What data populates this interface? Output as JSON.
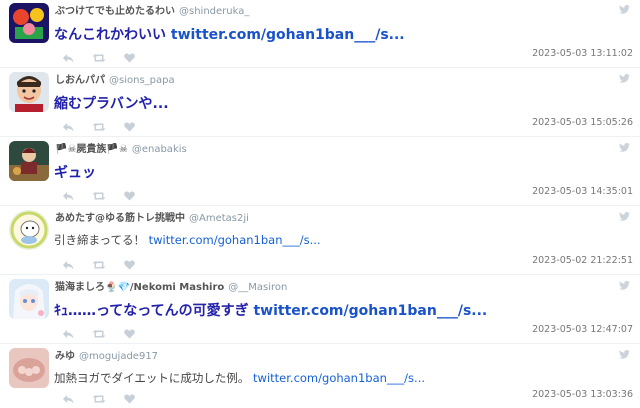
{
  "tweets": [
    {
      "name": "ぶつけてでも止めたるわい",
      "handle": "@shinderuka_",
      "text_prefix": "なんこれかわいい ",
      "link": "twitter.com/gohan1ban___/s...",
      "timestamp": "2023-05-03 13:11:02",
      "style": "big"
    },
    {
      "name": "しおんパパ",
      "handle": "@sions_papa",
      "text_prefix": "縮むプラバンや...",
      "link": "",
      "timestamp": "2023-05-03 15:05:26",
      "style": "big"
    },
    {
      "name": "🏴☠屍貴族🏴☠",
      "handle": "@enabakis",
      "text_prefix": "ギュッ",
      "link": "",
      "timestamp": "2023-05-03 14:35:01",
      "style": "big"
    },
    {
      "name": "あめたす@ゆる筋トレ挑戦中",
      "handle": "@Ametas2ji",
      "text_prefix": "引き締まってる！ ",
      "link": "twitter.com/gohan1ban___/s...",
      "timestamp": "2023-05-02 21:22:51",
      "style": "small"
    },
    {
      "name": "猫海ましろ🍨💎/Nekomi Mashiro",
      "handle": "@__Masiron",
      "text_prefix": "ｷｭ……ってなってんの可愛すぎ ",
      "link": "twitter.com/gohan1ban___/s...",
      "timestamp": "2023-05-03 12:47:07",
      "style": "big"
    },
    {
      "name": "みゆ",
      "handle": "@mogujade917",
      "text_prefix": "加熱ヨガでダイエットに成功した例。 ",
      "link": "twitter.com/gohan1ban___/s...",
      "timestamp": "2023-05-03 13:03:36",
      "style": "small"
    }
  ],
  "icons": {
    "reply": "reply-icon",
    "retweet": "retweet-icon",
    "like": "heart-icon",
    "bird": "twitter-bird-icon"
  },
  "colors": {
    "link": "#1a52c9",
    "text": "#2222aa",
    "meta": "#8899a6",
    "action": "#c7d0d8"
  }
}
